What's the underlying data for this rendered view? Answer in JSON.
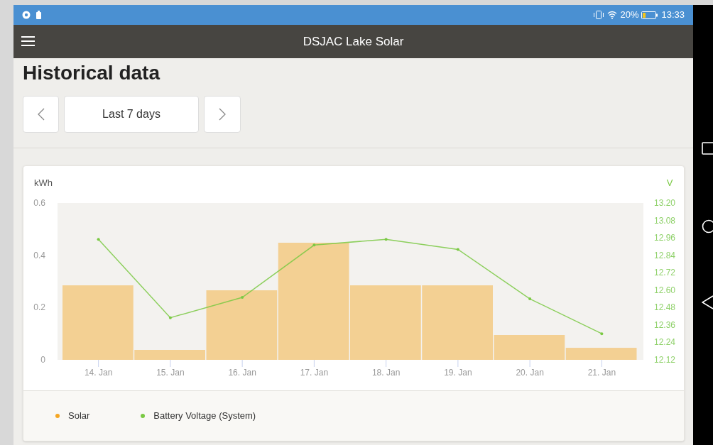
{
  "status_bar": {
    "battery": "20%",
    "time": "13:33"
  },
  "app_bar": {
    "title": "DSJAC Lake Solar"
  },
  "page_title": "Historical data",
  "period": {
    "label": "Last 7 days"
  },
  "chart": {
    "chart_data": {
      "type": "bar",
      "ylabel": "kWh",
      "y2label": "V",
      "categories": [
        "14. Jan",
        "15. Jan",
        "16. Jan",
        "17. Jan",
        "18. Jan",
        "19. Jan",
        "20. Jan",
        "21. Jan"
      ],
      "series": [
        {
          "name": "Solar",
          "color": "#f5a623",
          "type": "bar",
          "values": [
            0.285,
            0.038,
            0.266,
            0.448,
            0.285,
            0.285,
            0.095,
            0.046
          ]
        },
        {
          "name": "Battery Voltage (System)",
          "color": "#7ac943",
          "type": "line",
          "axis": "y2",
          "values": [
            12.95,
            12.41,
            12.55,
            12.91,
            12.95,
            12.88,
            12.54,
            12.3
          ]
        }
      ],
      "ylim": [
        0,
        0.6
      ],
      "yticks": [
        {
          "value": 0,
          "label": "0"
        },
        {
          "value": 0.2,
          "label": "0.2"
        },
        {
          "value": 0.4,
          "label": "0.4"
        },
        {
          "value": 0.6,
          "label": "0.6"
        }
      ],
      "y2lim": [
        12.12,
        13.2
      ],
      "y2ticks": [
        {
          "value": 13.2,
          "label": "13.20"
        },
        {
          "value": 13.08,
          "label": "13.08"
        },
        {
          "value": 12.96,
          "label": "12.96"
        },
        {
          "value": 12.84,
          "label": "12.84"
        },
        {
          "value": 12.72,
          "label": "12.72"
        },
        {
          "value": 12.6,
          "label": "12.60"
        },
        {
          "value": 12.48,
          "label": "12.48"
        },
        {
          "value": 12.36,
          "label": "12.36"
        },
        {
          "value": 12.24,
          "label": "12.24"
        },
        {
          "value": 12.12,
          "label": "12.12"
        }
      ]
    }
  }
}
